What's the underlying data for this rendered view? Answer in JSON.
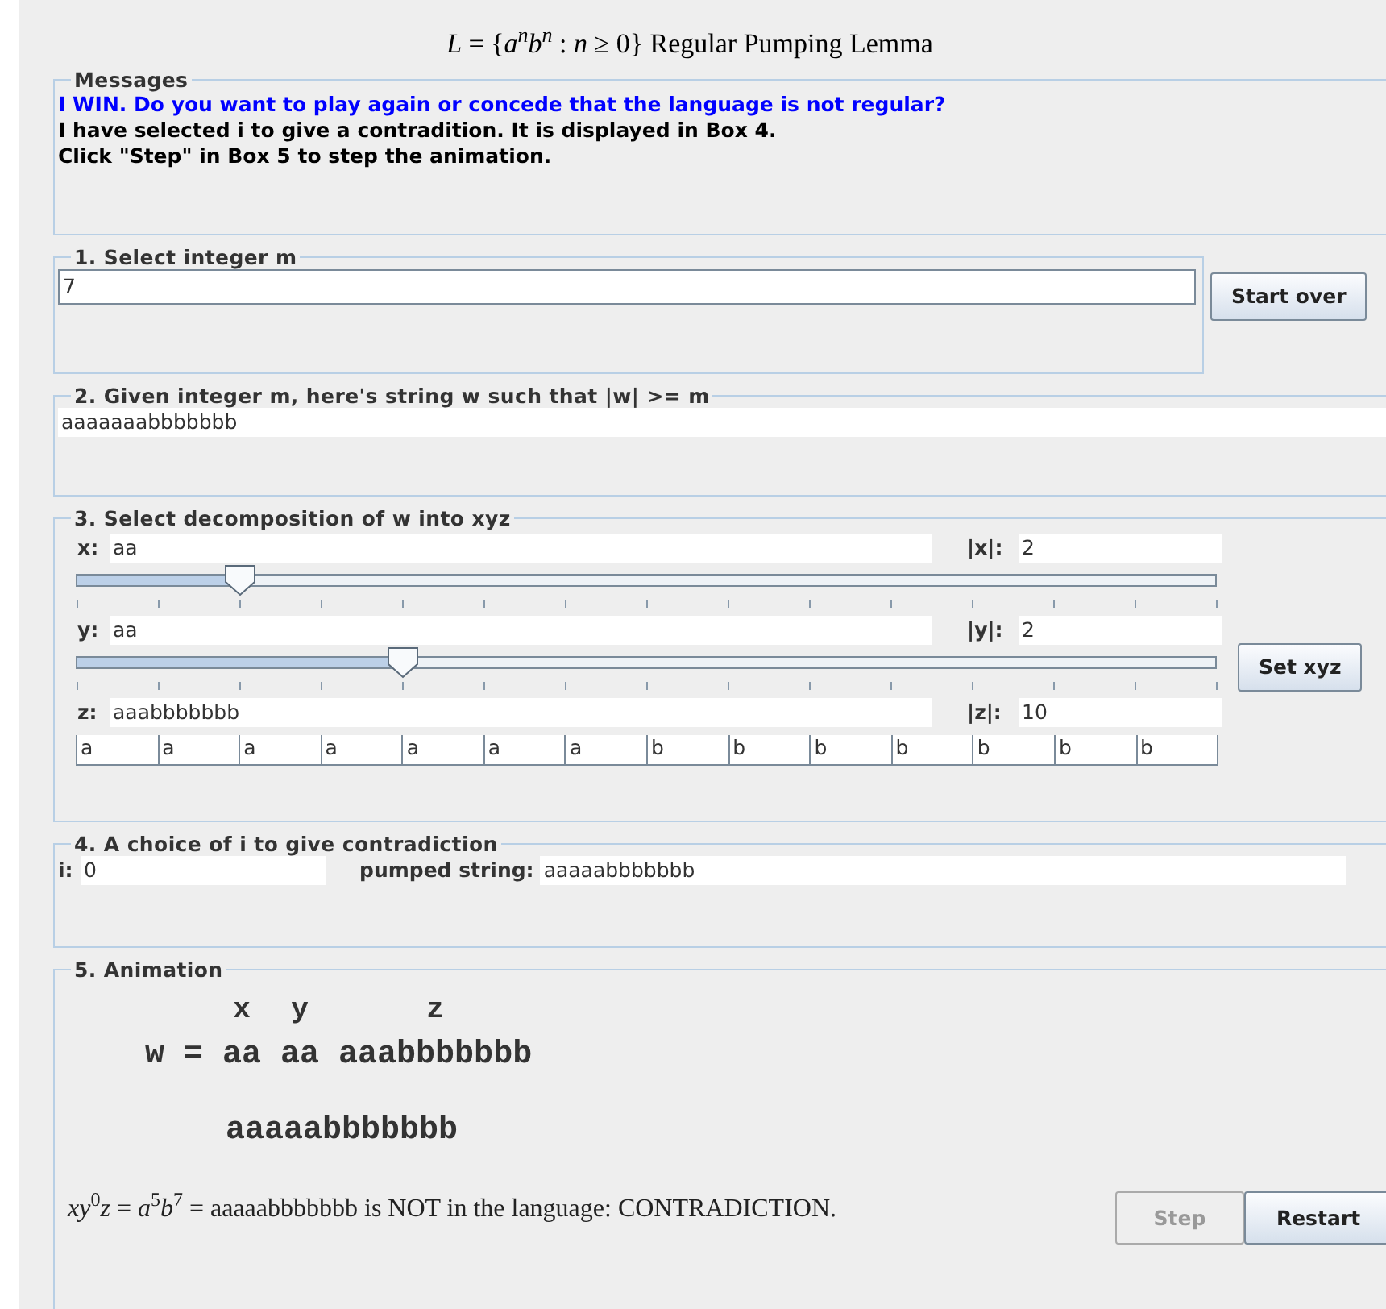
{
  "title": "*L* = {*a*$^{n}$*b*$^{n}$ : *n* ≥ 0} Regular Pumping Lemma",
  "messages": {
    "legend": "Messages",
    "lines": [
      {
        "text": "I WIN. Do you want to play again or concede that the language is not regular?",
        "color": "#0000ff"
      },
      {
        "text": "I have selected i to give a contradition. It is displayed in Box 4.",
        "color": "#000000"
      },
      {
        "text": "Click \"Step\" in Box 5 to step the animation.",
        "color": "#000000"
      }
    ]
  },
  "box1": {
    "legend": "1. Select integer m",
    "value": "7",
    "button": "Start over"
  },
  "box2": {
    "legend": "2. Given integer m, here's string w such that |w|  >= m",
    "value": "aaaaaaabbbbbbb"
  },
  "box3": {
    "legend": "3. Select decomposition of w into xyz",
    "button": "Set xyz",
    "rows": [
      {
        "label": "x:",
        "value": "aa",
        "len_label": "|x|:",
        "len": "2",
        "slider": {
          "level": 0.143
        }
      },
      {
        "label": "y:",
        "value": "aa",
        "len_label": "|y|:",
        "len": "2",
        "slider": {
          "level": 0.286
        }
      },
      {
        "label": "z:",
        "value": "aaabbbbbbb",
        "len_label": "|z|:",
        "len": "10"
      }
    ],
    "cells": [
      "a",
      "a",
      "a",
      "a",
      "a",
      "a",
      "a",
      "b",
      "b",
      "b",
      "b",
      "b",
      "b",
      "b"
    ]
  },
  "box4": {
    "legend": "4. A choice of i to give contradiction",
    "i_label": "i:",
    "i_value": "0",
    "pumped_label": "pumped string:",
    "pumped_value": "aaaaabbbbbbb"
  },
  "box5": {
    "legend": "5. Animation",
    "prefix": "w =",
    "parts": [
      {
        "label": "x",
        "text": "aa"
      },
      {
        "label": "y",
        "text": "aa"
      },
      {
        "label": "z",
        "text": "aaabbbbbbb"
      }
    ],
    "pumped": "aaaaabbbbbbb",
    "result": "*xy*$^{0}$*z* = *a*$^{5}$*b*$^{7}$ = aaaaabbbbbbb is NOT in the language: CONTRADICTION.",
    "buttons": [
      {
        "label": "Step",
        "disabled": true
      },
      {
        "label": "Restart",
        "disabled": false
      }
    ]
  }
}
